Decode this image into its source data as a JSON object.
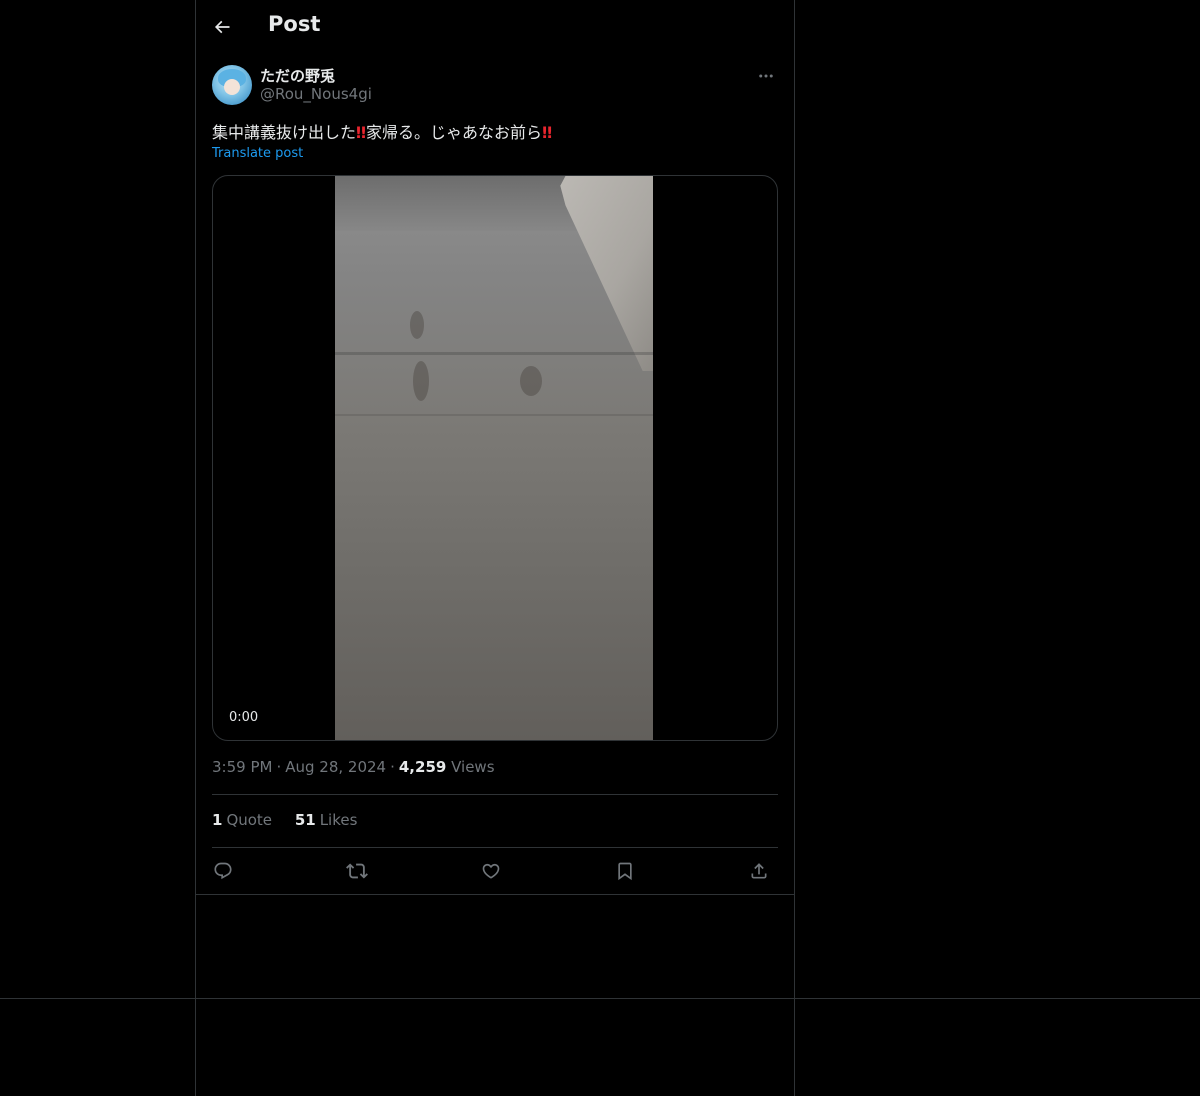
{
  "header": {
    "title": "Post"
  },
  "post": {
    "author": {
      "display_name": "ただの野兎",
      "handle": "@Rou_Nous4gi"
    },
    "text_parts": [
      "集中講義抜け出した",
      "‼",
      "家帰る。じゃあなお前ら",
      "‼"
    ],
    "translate_label": "Translate post",
    "video": {
      "timestamp": "0:00"
    },
    "time": "3:59 PM",
    "date": "Aug 28, 2024",
    "separator": "·",
    "views_count": "4,259",
    "views_label": "Views",
    "quotes_count": "1",
    "quotes_label": "Quote",
    "likes_count": "51",
    "likes_label": "Likes"
  },
  "icons": {
    "back": "arrow-left-icon",
    "more": "ellipsis-icon",
    "reply": "reply-icon",
    "repost": "repost-icon",
    "like": "heart-icon",
    "bookmark": "bookmark-icon",
    "share": "share-icon"
  },
  "colors": {
    "background": "#000000",
    "text": "#e7e9ea",
    "secondary": "#71767b",
    "link": "#1d9bf0",
    "border": "#2f3336",
    "emoji_red": "#e8252e"
  }
}
